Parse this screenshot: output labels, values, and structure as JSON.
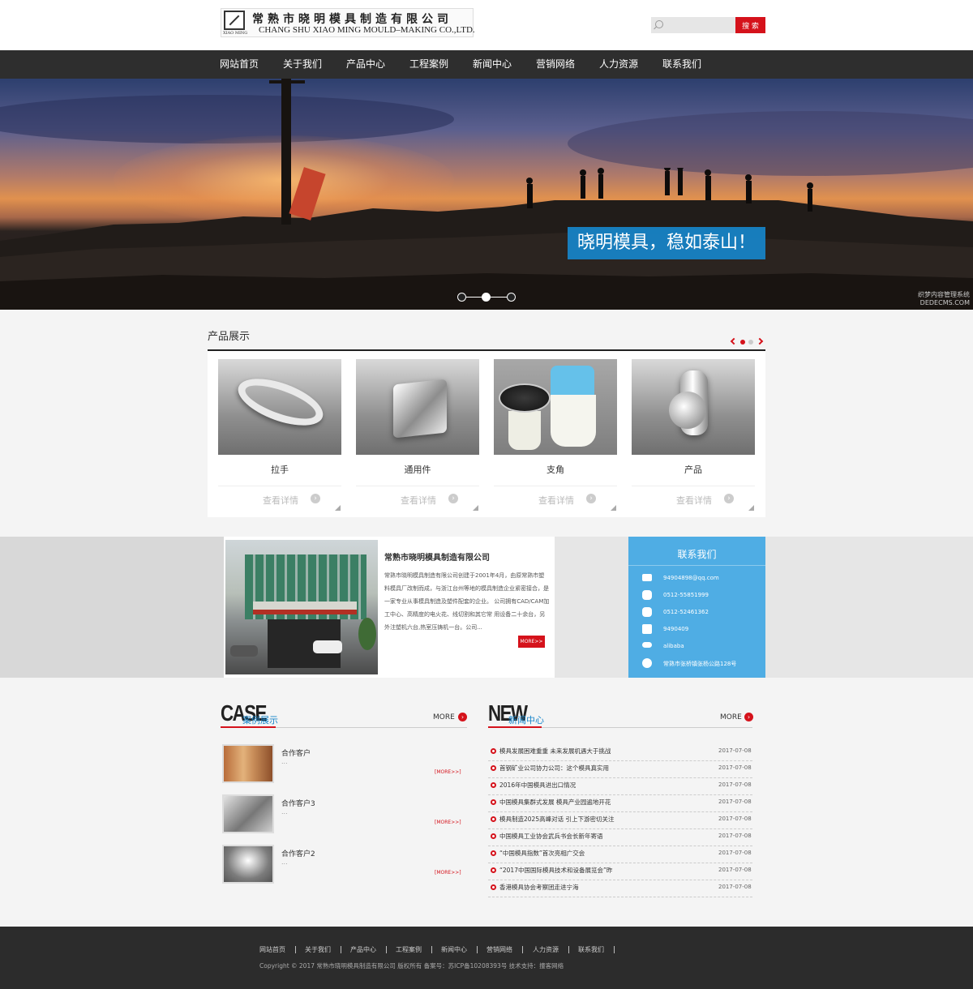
{
  "header": {
    "logo_mark_text": "XIAO MING",
    "company_cn": "常熟市晓明模具制造有限公司",
    "company_en": "CHANG SHU XIAO MING MOULD–MAKING CO.,LTD.",
    "search_placeholder": "",
    "search_button": "搜 索"
  },
  "nav": {
    "items": [
      "网站首页",
      "关于我们",
      "产品中心",
      "工程案例",
      "新闻中心",
      "营销网络",
      "人力资源",
      "联系我们"
    ]
  },
  "banner": {
    "slogan": "晓明模具，稳如泰山！",
    "slides": 3,
    "active_slide": 2,
    "watermark": "织梦内容管理系统 DEDECMS.COM"
  },
  "products": {
    "title": "产品展示",
    "items": [
      {
        "name": "拉手",
        "detail": "查看详情"
      },
      {
        "name": "通用件",
        "detail": "查看详情"
      },
      {
        "name": "支角",
        "detail": "查看详情"
      },
      {
        "name": "产品",
        "detail": "查看详情"
      }
    ],
    "detail_icon": "chevron-right-circle-icon"
  },
  "about": {
    "title": "常熟市晓明模具制造有限公司",
    "text": "常熟市晓明模具制造有限公司创建于2001年4月，由原常熟市塑料模具厂改制而成，与浙江台州等地的模具制造企业紧密接合，是一家专业从事模具制造及塑件配套的企业。 公司拥有CAD/CAM加工中心、高精度的电火花、线切割和其它常 用设备二十余台，另外注塑机六台,热室压铸机一台。公司...",
    "more": "MORE>>"
  },
  "contact": {
    "title": "联系我们",
    "items": [
      {
        "icon": "mail-icon",
        "text": "94904898@qq.com"
      },
      {
        "icon": "phone-icon",
        "text": "0512-55851999"
      },
      {
        "icon": "phone-icon",
        "text": "0512-52461362"
      },
      {
        "icon": "printer-icon",
        "text": "9490409"
      },
      {
        "icon": "alibaba-icon",
        "text": "alibaba"
      },
      {
        "icon": "location-icon",
        "text": "常熟市张桥镇张杨公路128号"
      }
    ]
  },
  "cases": {
    "big": "CASE",
    "sub": "案例展示",
    "more": "MORE",
    "items": [
      {
        "name": "合作客户",
        "desc": "...",
        "more": "[MORE>>]"
      },
      {
        "name": "合作客户3",
        "desc": "...",
        "more": "[MORE>>]"
      },
      {
        "name": "合作客户2",
        "desc": "...",
        "more": "[MORE>>]"
      }
    ]
  },
  "news": {
    "big": "NEW",
    "sub": "新闻中心",
    "more": "MORE",
    "items": [
      {
        "title": "模具发展困难重重  未来发展机遇大于挑战",
        "date": "2017-07-08"
      },
      {
        "title": "首钢矿业公司协力公司：这个模具真实用",
        "date": "2017-07-08"
      },
      {
        "title": "2016年中国模具进出口情况",
        "date": "2017-07-08"
      },
      {
        "title": "中国模具集群式发展  模具产业园遍地开花",
        "date": "2017-07-08"
      },
      {
        "title": "模具制造2025高峰对话  引上下游密切关注",
        "date": "2017-07-08"
      },
      {
        "title": "中国模具工业协会武兵书会长新年寄语",
        "date": "2017-07-08"
      },
      {
        "title": "“中国模具指数”首次亮相广交会",
        "date": "2017-07-08"
      },
      {
        "title": "“2017中国国际模具技术和设备展览会”昨",
        "date": "2017-07-08"
      },
      {
        "title": "香港模具协会考察团走进宁海",
        "date": "2017-07-08"
      }
    ]
  },
  "footer": {
    "nav": [
      "网站首页",
      "关于我们",
      "产品中心",
      "工程案例",
      "新闻中心",
      "营销网络",
      "人力资源",
      "联系我们"
    ],
    "copyright": "Copyright © 2017 常熟市晓明模具制造有限公司 版权所有 备案号：苏ICP备10208393号 技术支持：撞客网络"
  },
  "colors": {
    "accent_red": "#d5121b",
    "accent_blue": "#1785ca",
    "contact_blue": "#4fade4",
    "nav_bg": "#2e2e2e",
    "footer_bg": "#2c2c2c"
  }
}
